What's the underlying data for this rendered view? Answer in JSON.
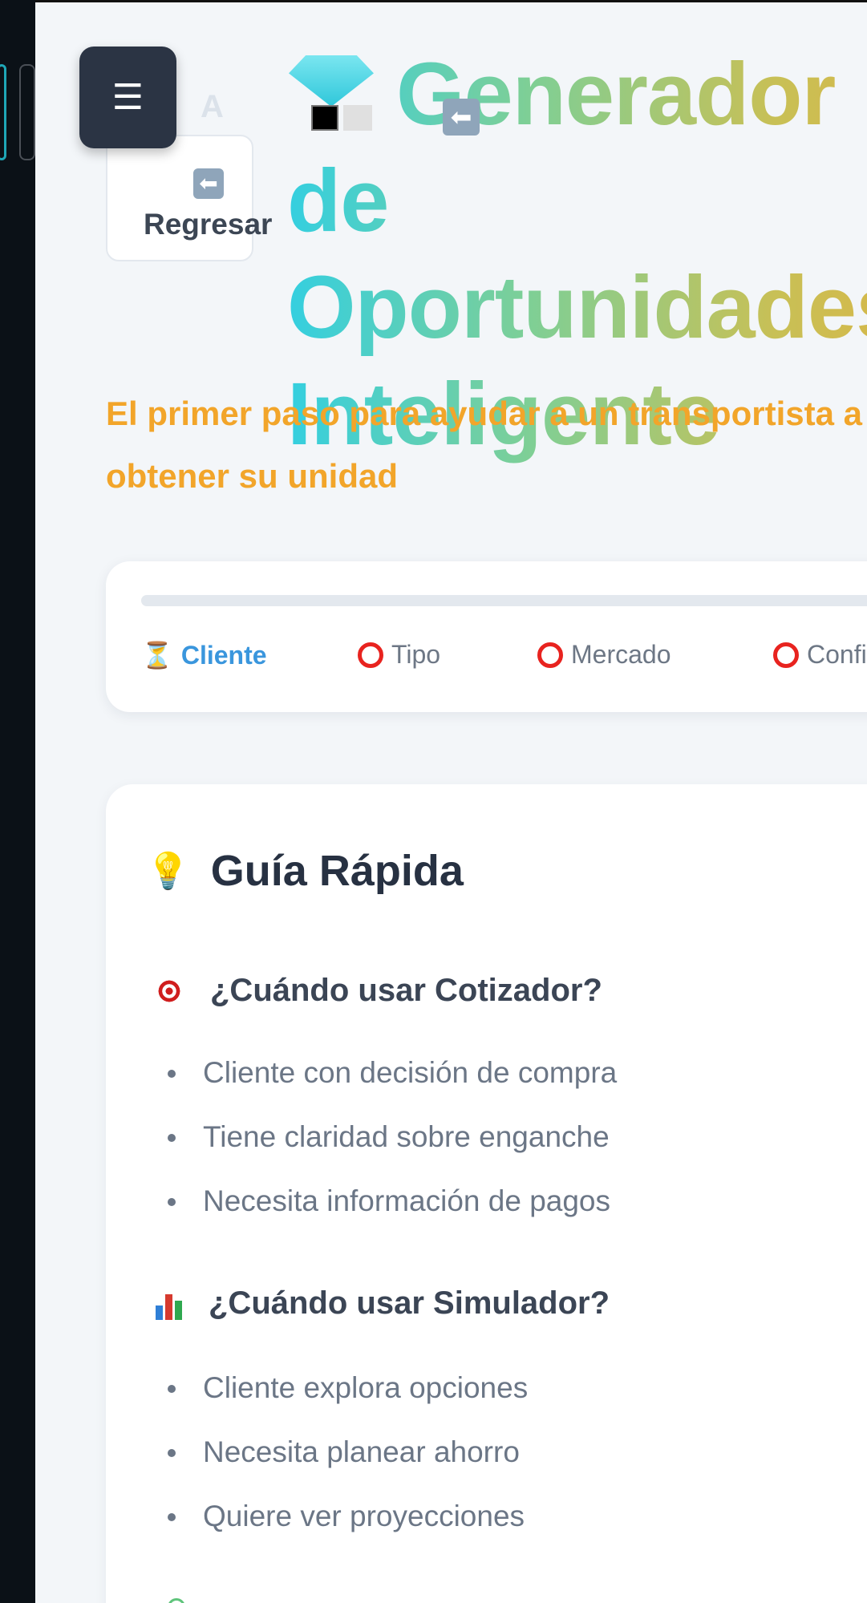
{
  "header": {
    "menu_icon": "☰",
    "ghost_letter": "A",
    "back_icon": "⬅",
    "back_label": "Regresar",
    "title": "Generador de Oportunidades Inteligente",
    "title_arrow": "⬅",
    "subtitle": "El primer paso para ayudar a un transportista a obtener su unidad"
  },
  "steps": {
    "active_icon": "⏳",
    "items": [
      {
        "label": "Cliente",
        "state": "active"
      },
      {
        "label": "Tipo",
        "state": "pending"
      },
      {
        "label": "Mercado",
        "state": "pending"
      },
      {
        "label": "Confirmar",
        "state": "pending"
      }
    ]
  },
  "guide": {
    "title": "Guía Rápida",
    "sections": [
      {
        "title": "¿Cuándo usar Cotizador?",
        "icon": "target-icon",
        "items": [
          "Cliente con decisión de compra",
          "Tiene claridad sobre enganche",
          "Necesita información de pagos"
        ]
      },
      {
        "title": "¿Cuándo usar Simulador?",
        "icon": "bar-chart-icon",
        "items": [
          "Cliente explora opciones",
          "Necesita planear ahorro",
          "Quiere ver proyecciones"
        ]
      }
    ]
  },
  "colors": {
    "accent": "#3a96dd",
    "subtitle": "#f2a52a",
    "pending_ring": "#e8231f"
  }
}
